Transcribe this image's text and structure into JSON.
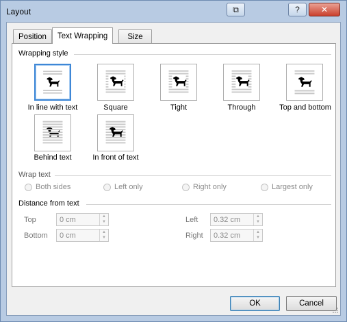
{
  "window": {
    "title": "Layout",
    "buttons": {
      "restore_glyph": "⧉",
      "help_glyph": "?",
      "close_glyph": "✕"
    }
  },
  "tabs": [
    {
      "label": "Position",
      "active": false
    },
    {
      "label": "Text Wrapping",
      "active": true
    },
    {
      "label": "Size",
      "active": false
    }
  ],
  "wrapping_style": {
    "heading": "Wrapping style",
    "options": [
      {
        "label": "In line with text",
        "icon": "inline-wrap-icon",
        "selected": true
      },
      {
        "label": "Square",
        "icon": "square-wrap-icon",
        "selected": false
      },
      {
        "label": "Tight",
        "icon": "tight-wrap-icon",
        "selected": false
      },
      {
        "label": "Through",
        "icon": "through-wrap-icon",
        "selected": false
      },
      {
        "label": "Top and bottom",
        "icon": "top-bottom-wrap-icon",
        "selected": false
      },
      {
        "label": "Behind text",
        "icon": "behind-text-icon",
        "selected": false
      },
      {
        "label": "In front of text",
        "icon": "in-front-text-icon",
        "selected": false
      }
    ]
  },
  "wrap_text": {
    "heading": "Wrap text",
    "options": [
      "Both sides",
      "Left only",
      "Right only",
      "Largest only"
    ]
  },
  "distance": {
    "heading": "Distance from text",
    "top": {
      "label": "Top",
      "value": "0 cm"
    },
    "bottom": {
      "label": "Bottom",
      "value": "0 cm"
    },
    "left": {
      "label": "Left",
      "value": "0.32 cm"
    },
    "right": {
      "label": "Right",
      "value": "0.32 cm"
    }
  },
  "footer": {
    "ok_label": "OK",
    "cancel_label": "Cancel"
  },
  "colors": {
    "selected_border": "#3e87d6",
    "frame": "#b8cbe3",
    "dialog_bg": "#f0f0f0",
    "text_lines": "#c8c8c8"
  }
}
